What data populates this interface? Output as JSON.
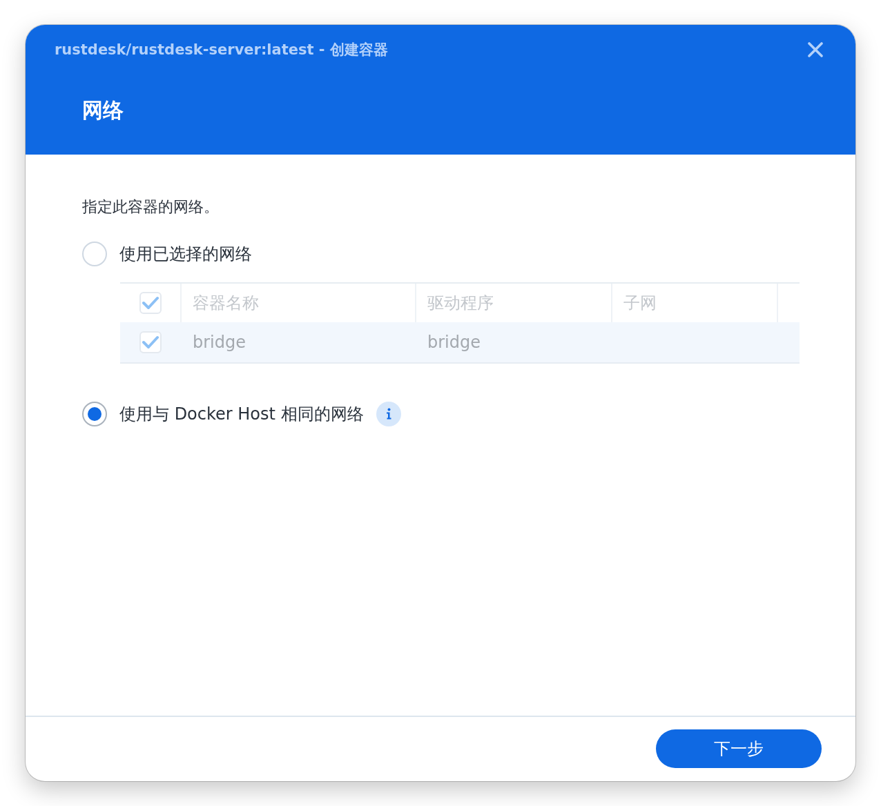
{
  "dialog": {
    "title": "rustdesk/rustdesk-server:latest - 创建容器",
    "step_title": "网络"
  },
  "description": "指定此容器的网络。",
  "options": [
    {
      "kind": "table",
      "label": "使用已选择的网络",
      "selected": false,
      "info": false
    },
    {
      "kind": "plain",
      "label": "使用与 Docker Host 相同的网络",
      "selected": true,
      "info": true
    }
  ],
  "table": {
    "disabled": true,
    "all_checked": true,
    "columns": [
      "容器名称",
      "驱动程序",
      "子网"
    ],
    "rows": [
      {
        "checked": true,
        "selected": true,
        "name": "bridge",
        "driver": "bridge"
      }
    ]
  },
  "footer": {
    "buttons": [
      {
        "kind": "primary",
        "label": "下一步"
      }
    ]
  }
}
